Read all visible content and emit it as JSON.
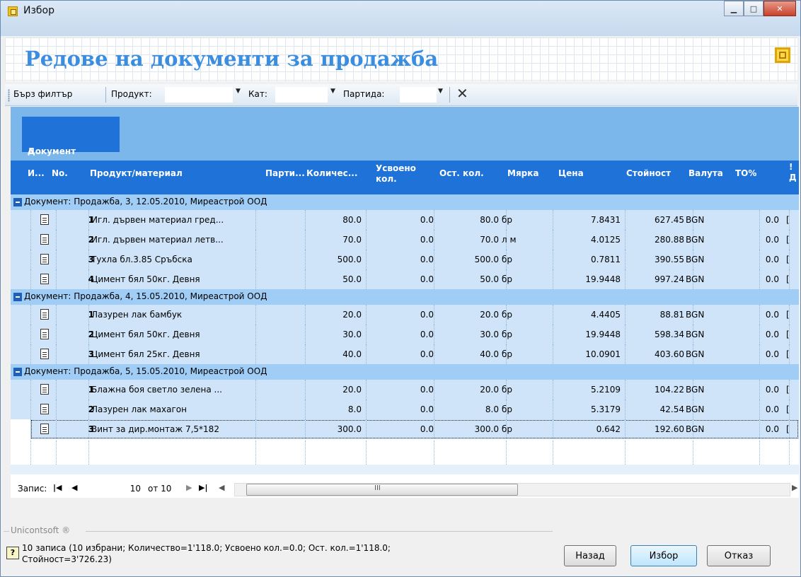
{
  "window": {
    "title": "Избор"
  },
  "header": {
    "title": "Редове на документи за продажба"
  },
  "toolbar": {
    "quick_filter": "Бърз филтър",
    "product_label": "Продукт:",
    "cat_label": "Кат:",
    "batch_label": "Партида:"
  },
  "grid": {
    "group_by": "Документ",
    "group_sort_glyph": "∆",
    "columns": [
      "И...",
      "No.",
      "Продукт/материал",
      "Парти...",
      "Количес...",
      "Усвоено кол.",
      "Ост. кол.",
      "Мярка",
      "Цена",
      "Стойност",
      "Валута",
      "ТО%",
      "! Д"
    ],
    "groups": [
      {
        "label": "Документ: Продажба, 3, 12.05.2010, Миреастрой ООД",
        "rows": [
          {
            "no": "1",
            "product": "Игл. дървен материал гред...",
            "qty": "80.0",
            "used": "0.0",
            "rem": "80.0",
            "unit": "бр",
            "price": "7.8431",
            "value": "627.45",
            "cur": "BGN",
            "to": "0.0",
            "d": "["
          },
          {
            "no": "2",
            "product": "Игл. дървен материал летв...",
            "qty": "70.0",
            "used": "0.0",
            "rem": "70.0",
            "unit": "л м",
            "price": "4.0125",
            "value": "280.88",
            "cur": "BGN",
            "to": "0.0",
            "d": "["
          },
          {
            "no": "3",
            "product": "Тухла бл.3.85 Сръбска",
            "qty": "500.0",
            "used": "0.0",
            "rem": "500.0",
            "unit": "бр",
            "price": "0.7811",
            "value": "390.55",
            "cur": "BGN",
            "to": "0.0",
            "d": "["
          },
          {
            "no": "4",
            "product": "Цимент бял 50кг. Девня",
            "qty": "50.0",
            "used": "0.0",
            "rem": "50.0",
            "unit": "бр",
            "price": "19.9448",
            "value": "997.24",
            "cur": "BGN",
            "to": "0.0",
            "d": "["
          }
        ]
      },
      {
        "label": "Документ: Продажба, 4, 15.05.2010, Миреастрой ООД",
        "rows": [
          {
            "no": "1",
            "product": "Лазурен лак бамбук",
            "qty": "20.0",
            "used": "0.0",
            "rem": "20.0",
            "unit": "бр",
            "price": "4.4405",
            "value": "88.81",
            "cur": "BGN",
            "to": "0.0",
            "d": "["
          },
          {
            "no": "2",
            "product": "Цимент бял 50кг. Девня",
            "qty": "30.0",
            "used": "0.0",
            "rem": "30.0",
            "unit": "бр",
            "price": "19.9448",
            "value": "598.34",
            "cur": "BGN",
            "to": "0.0",
            "d": "["
          },
          {
            "no": "3",
            "product": "Цимент бял 25кг. Девня",
            "qty": "40.0",
            "used": "0.0",
            "rem": "40.0",
            "unit": "бр",
            "price": "10.0901",
            "value": "403.60",
            "cur": "BGN",
            "to": "0.0",
            "d": "["
          }
        ]
      },
      {
        "label": "Документ: Продажба, 5, 15.05.2010, Миреастрой ООД",
        "rows": [
          {
            "no": "1",
            "product": "Блажна боя светло зелена ...",
            "qty": "20.0",
            "used": "0.0",
            "rem": "20.0",
            "unit": "бр",
            "price": "5.2109",
            "value": "104.22",
            "cur": "BGN",
            "to": "0.0",
            "d": "["
          },
          {
            "no": "2",
            "product": "Лазурен лак махагон",
            "qty": "8.0",
            "used": "0.0",
            "rem": "8.0",
            "unit": "бр",
            "price": "5.3179",
            "value": "42.54",
            "cur": "BGN",
            "to": "0.0",
            "d": "["
          },
          {
            "no": "3",
            "product": "Винт за дир.монтаж 7,5*182",
            "qty": "300.0",
            "used": "0.0",
            "rem": "300.0",
            "unit": "бр",
            "price": "0.642",
            "value": "192.60",
            "cur": "BGN",
            "to": "0.0",
            "d": "["
          }
        ]
      }
    ]
  },
  "navigator": {
    "label": "Запис:",
    "current": "10",
    "of_text": "от 10",
    "scroll_glyph": "III"
  },
  "footer": {
    "brand": "Unicontsoft ®",
    "status_line1": "10 записа (10 избрани; Количество=1'118.0; Усвоено кол.=0.0; Ост. кол.=1'118.0;",
    "status_line2": "Стойност=3'726.23)",
    "btn_back": "Назад",
    "btn_select": "Избор",
    "btn_cancel": "Отказ"
  },
  "colors": {
    "accent": "#1f73d8",
    "group_row": "#9fcdf6",
    "data_row": "#cfe4f8",
    "title_blue": "#3b8de0"
  },
  "icons": {
    "document": "document-icon",
    "collapse": "minus-icon",
    "help": "help-icon"
  }
}
